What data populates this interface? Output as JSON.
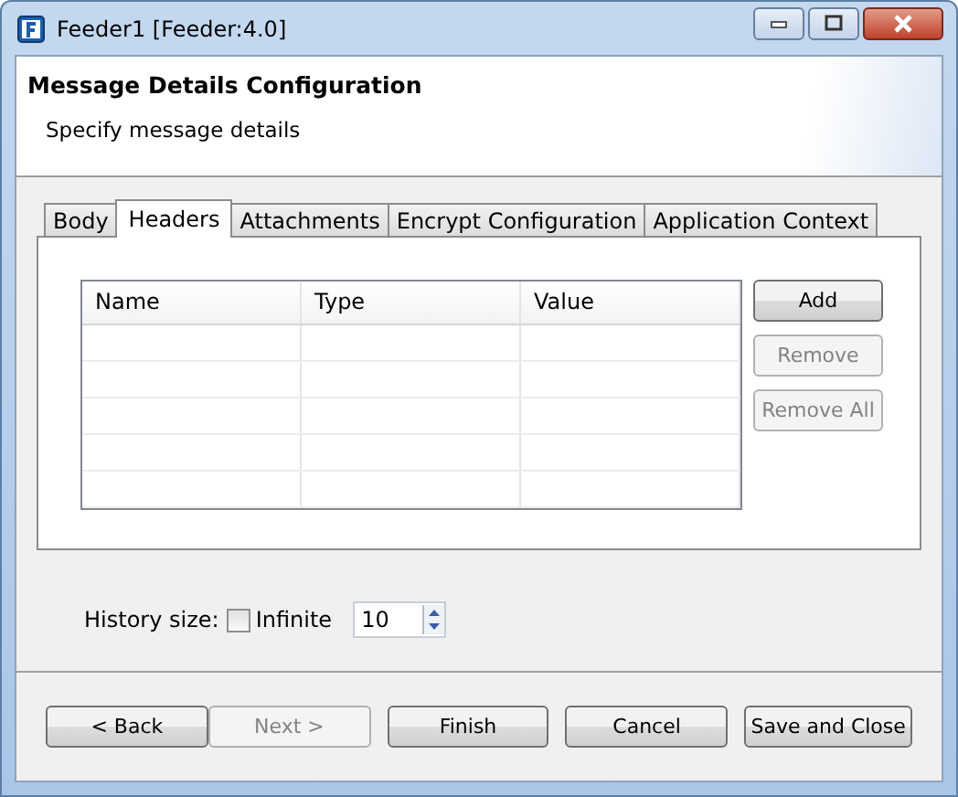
{
  "window": {
    "title": "Feeder1 [Feeder:4.0]"
  },
  "header": {
    "title": "Message Details Configuration",
    "subtitle": "Specify message details"
  },
  "tabs": [
    {
      "label": "Body",
      "selected": false
    },
    {
      "label": "Headers",
      "selected": true
    },
    {
      "label": "Attachments",
      "selected": false
    },
    {
      "label": "Encrypt Configuration",
      "selected": false
    },
    {
      "label": "Application Context",
      "selected": false
    }
  ],
  "table": {
    "columns": [
      "Name",
      "Type",
      "Value"
    ]
  },
  "side_buttons": [
    {
      "label": "Add",
      "disabled": false
    },
    {
      "label": "Remove",
      "disabled": true
    },
    {
      "label": "Remove All",
      "disabled": true
    }
  ],
  "history": {
    "label": "History size:",
    "infinite_label": "Infinite",
    "infinite_checked": false,
    "value": "10"
  },
  "buttons": [
    {
      "label": "< Back",
      "disabled": false
    },
    {
      "label": "Next >",
      "disabled": true
    },
    {
      "label": "Finish",
      "disabled": false
    },
    {
      "label": "Cancel",
      "disabled": false
    },
    {
      "label": "Save and Close",
      "disabled": false
    }
  ]
}
